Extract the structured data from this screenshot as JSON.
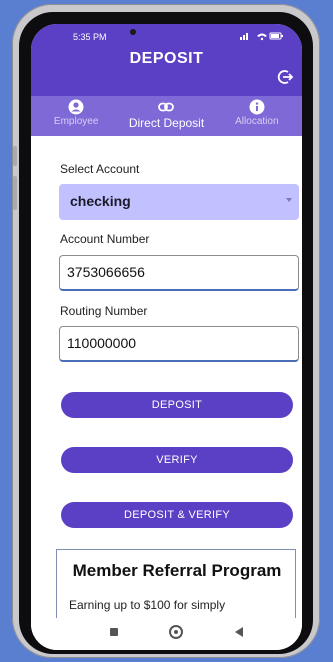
{
  "status_bar": {
    "time": "5:35 PM",
    "icons": "signal-wifi-battery-icons"
  },
  "header": {
    "title": "DEPOSIT"
  },
  "tabs": [
    {
      "label": "Employee",
      "icon": "person-icon"
    },
    {
      "label": "Direct Deposit",
      "icon": "link-icon"
    },
    {
      "label": "Allocation",
      "icon": "info-icon"
    }
  ],
  "form": {
    "select_account_label": "Select Account",
    "select_account_value": "checking",
    "account_number_label": "Account Number",
    "account_number_value": "3753066656",
    "routing_number_label": "Routing Number",
    "routing_number_value": "110000000"
  },
  "buttons": {
    "deposit": "DEPOSIT",
    "verify": "VERIFY",
    "deposit_verify": "DEPOSIT & VERIFY"
  },
  "card": {
    "title": "Member Referral Program",
    "body": "Earning up to $100 for simply"
  },
  "colors": {
    "primary": "#5b3fc4",
    "tabbar": "#7f69d6",
    "select_bg": "#c2c1ff"
  }
}
